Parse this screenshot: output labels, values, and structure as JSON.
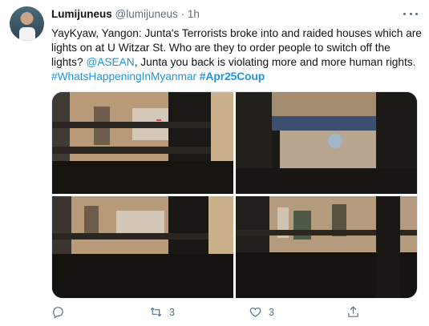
{
  "tweet": {
    "name": "Lumijuneus",
    "handle": "@lumijuneus",
    "separator": "·",
    "time": "1h",
    "text_part1": "YayKyaw, Yangon: Junta's Terrorists broke into and raided houses which are lights on at U Witzar St. Who are they to order people to switch off the lights? ",
    "mention": "@ASEAN",
    "text_part2": ", Junta you back is violating more and more human rights.",
    "hashtag1": "#WhatsHappeningInMyanmar",
    "hashtag2": "#Apr25Coup",
    "retweets": "3",
    "likes": "3"
  },
  "icons": {
    "reply": "reply-icon",
    "retweet": "retweet-icon",
    "like": "like-icon",
    "share": "share-icon",
    "more": "more-icon"
  },
  "colors": {
    "link": "#1b95e0",
    "muted": "#5b7083",
    "text": "#0f1419"
  }
}
